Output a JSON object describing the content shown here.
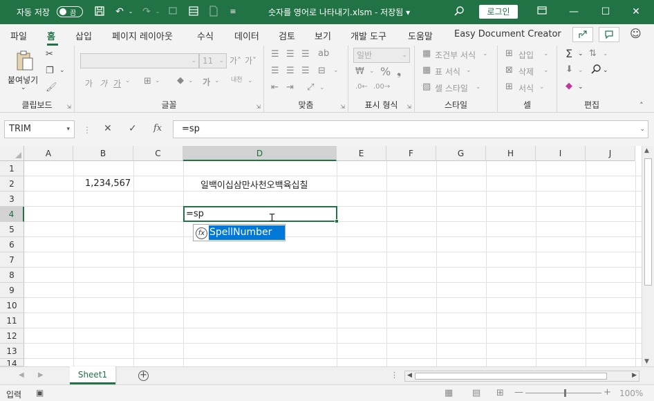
{
  "titlebar": {
    "autosave_label": "자동 저장",
    "autosave_state": "끔",
    "doc_title": "숫자를 영어로 나타내기.xlsm  -  저장됨 ▾",
    "login_label": "로그인"
  },
  "tabs": [
    "파일",
    "홈",
    "삽입",
    "페이지 레이아웃",
    "수식",
    "데이터",
    "검토",
    "보기",
    "개발 도구",
    "도움말",
    "Easy Document Creator"
  ],
  "ribbon": {
    "clipboard": {
      "label": "클립보드",
      "paste": "붙여넣기"
    },
    "font": {
      "label": "글꼴",
      "font_name": "",
      "font_size": "11"
    },
    "alignment": {
      "label": "맞춤"
    },
    "number": {
      "label": "표시 형식",
      "format": "일반"
    },
    "styles": {
      "label": "스타일",
      "conditional": "조건부 서식",
      "table": "표 서식",
      "cell_style": "셀 스타일"
    },
    "cells": {
      "label": "셀",
      "insert": "삽입",
      "delete": "삭제",
      "format": "서식"
    },
    "editing": {
      "label": "편집"
    }
  },
  "formula_bar": {
    "name_box": "TRIM",
    "formula": "=sp"
  },
  "grid": {
    "columns": [
      "A",
      "B",
      "C",
      "D",
      "E",
      "F",
      "G",
      "H",
      "I",
      "J"
    ],
    "selected_column": "D",
    "rows": [
      "1",
      "2",
      "3",
      "4",
      "5",
      "6",
      "7",
      "8",
      "9",
      "10",
      "11",
      "12",
      "13",
      "14"
    ],
    "selected_row": "4",
    "cells": {
      "B2": "1,234,567",
      "D2": "일백이십삼만사천오백육십칠",
      "D4": "=sp"
    },
    "autocomplete": {
      "item": "SpellNumber"
    }
  },
  "sheets": {
    "active": "Sheet1"
  },
  "statusbar": {
    "mode": "입력",
    "zoom": "100%"
  }
}
